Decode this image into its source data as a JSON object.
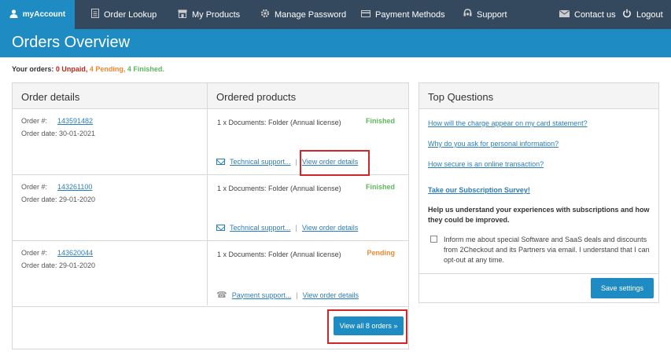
{
  "nav": {
    "brand": "myAccount",
    "items": [
      {
        "label": "Order Lookup",
        "icon": "document-icon"
      },
      {
        "label": "My Products",
        "icon": "store-icon"
      },
      {
        "label": "Manage Password",
        "icon": "gear-icon"
      },
      {
        "label": "Payment Methods",
        "icon": "card-icon"
      },
      {
        "label": "Support",
        "icon": "support-icon"
      }
    ],
    "contact": "Contact us",
    "logout": "Logout"
  },
  "page": {
    "title": "Orders Overview"
  },
  "summary": {
    "prefix": "Your orders:",
    "unpaid": "0 Unpaid,",
    "pending": "4 Pending,",
    "finished": "4 Finished."
  },
  "orders": {
    "header_details": "Order details",
    "header_products": "Ordered products",
    "order_label": "Order #:",
    "rows": [
      {
        "number": "143591482",
        "date": "Order date: 30-01-2021",
        "product": "1 x Documents: Folder (Annual license)",
        "status": "Finished",
        "support": "Technical support...",
        "details": "View order details"
      },
      {
        "number": "143261100",
        "date": "Order date: 29-01-2020",
        "product": "1 x Documents: Folder (Annual license)",
        "status": "Finished",
        "support": "Technical support...",
        "details": "View order details"
      },
      {
        "number": "143620044",
        "date": "Order date: 29-01-2020",
        "product": "1 x Documents: Folder (Annual license)",
        "status": "Pending",
        "support": "Payment support...",
        "details": "View order details"
      }
    ],
    "separator": "|",
    "view_all": "View all 8 orders »"
  },
  "top_questions": {
    "title": "Top Questions",
    "links": [
      "How will the charge appear on my card statement?",
      "Why do you ask for personal information?",
      "How secure is an online transaction?"
    ],
    "survey": "Take our Subscription Survey!",
    "help": "Help us understand your experiences with subscriptions and how they could be improved.",
    "optin": "Inform me about special Software and SaaS deals and discounts from 2Checkout and its Partners via email. I understand that I can opt-out at any time.",
    "optin_checked": false,
    "save": "Save settings"
  },
  "colors": {
    "nav_bg": "#34495e",
    "accent": "#1e8bc3",
    "unpaid": "#c0271a",
    "pending": "#f0882f",
    "finished": "#5cb85c",
    "highlight_box": "#d0262a"
  }
}
